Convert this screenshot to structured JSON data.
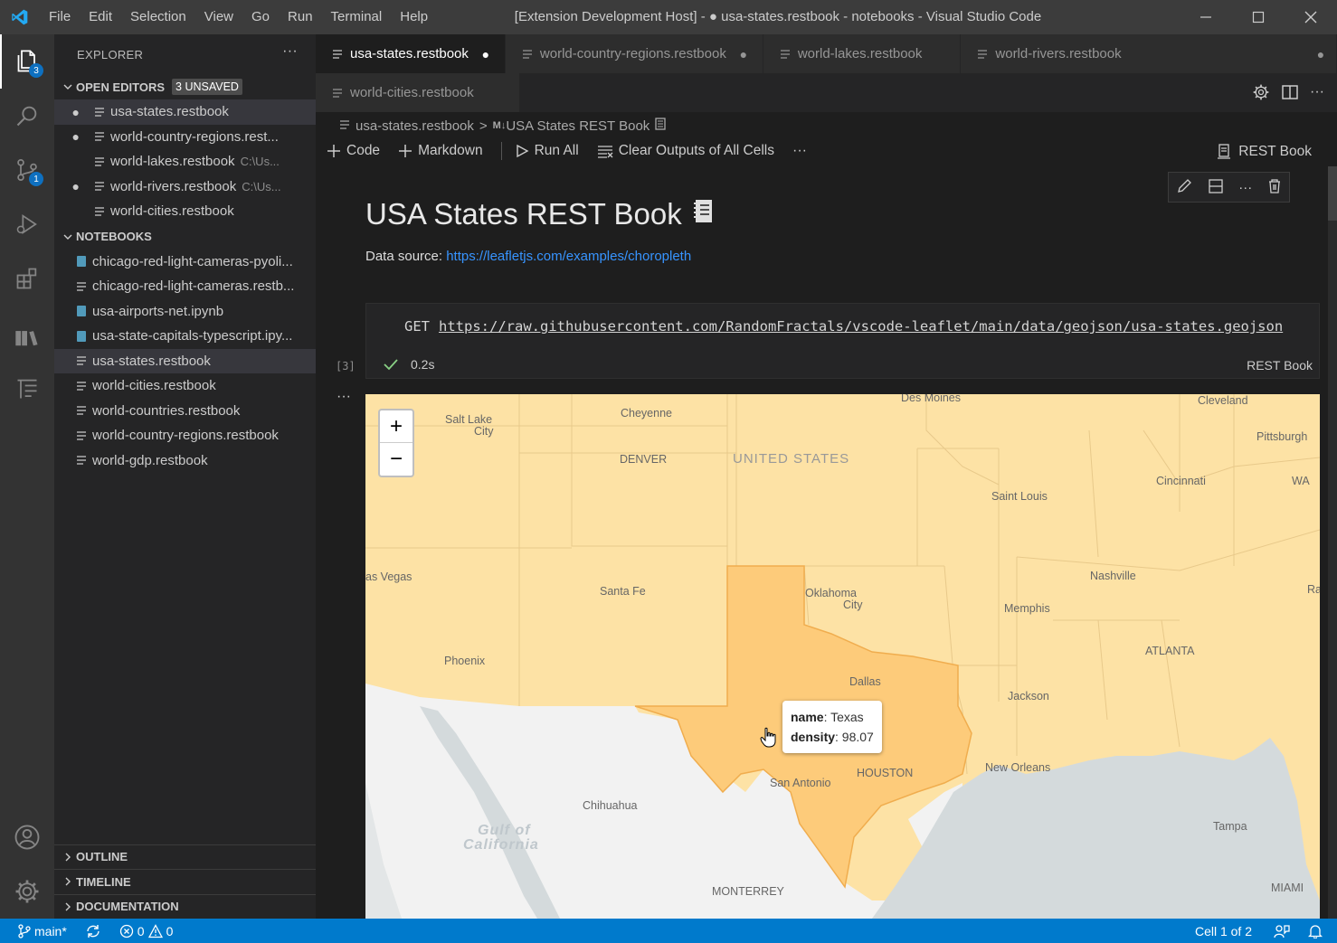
{
  "menu": [
    "File",
    "Edit",
    "Selection",
    "View",
    "Go",
    "Run",
    "Terminal",
    "Help"
  ],
  "window_title": "[Extension Development Host] - ● usa-states.restbook - notebooks - Visual Studio Code",
  "activity": {
    "explorer_badge": "3",
    "scm_badge": "1"
  },
  "sidebar": {
    "title": "EXPLORER",
    "open_editors": {
      "label": "OPEN EDITORS",
      "unsaved": "3 UNSAVED",
      "items": [
        {
          "name": "usa-states.restbook",
          "path": "",
          "dirty": true
        },
        {
          "name": "world-country-regions.rest...",
          "path": "",
          "dirty": true
        },
        {
          "name": "world-lakes.restbook",
          "path": "C:\\Us...",
          "dirty": false
        },
        {
          "name": "world-rivers.restbook",
          "path": "C:\\Us...",
          "dirty": true
        },
        {
          "name": "world-cities.restbook",
          "path": "",
          "dirty": false
        }
      ]
    },
    "notebooks": {
      "label": "NOTEBOOKS",
      "items": [
        {
          "name": "chicago-red-light-cameras-pyoli...",
          "kind": "ipynb"
        },
        {
          "name": "chicago-red-light-cameras.restb...",
          "kind": "restbook"
        },
        {
          "name": "usa-airports-net.ipynb",
          "kind": "ipynb"
        },
        {
          "name": "usa-state-capitals-typescript.ipy...",
          "kind": "ipynb"
        },
        {
          "name": "usa-states.restbook",
          "kind": "restbook"
        },
        {
          "name": "world-cities.restbook",
          "kind": "restbook"
        },
        {
          "name": "world-countries.restbook",
          "kind": "restbook"
        },
        {
          "name": "world-country-regions.restbook",
          "kind": "restbook"
        },
        {
          "name": "world-gdp.restbook",
          "kind": "restbook"
        }
      ]
    },
    "bottom_sections": [
      "OUTLINE",
      "TIMELINE",
      "DOCUMENTATION"
    ]
  },
  "tabs_row1": [
    {
      "label": "usa-states.restbook",
      "dirty": true,
      "active": true
    },
    {
      "label": "world-country-regions.restbook",
      "dirty": true,
      "active": false
    },
    {
      "label": "world-lakes.restbook",
      "dirty": false,
      "active": false
    },
    {
      "label": "world-rivers.restbook",
      "dirty": true,
      "active": false
    }
  ],
  "tabs_row2": [
    {
      "label": "world-cities.restbook",
      "dirty": false,
      "active": false
    }
  ],
  "breadcrumb": {
    "file": "usa-states.restbook",
    "separator": ">",
    "md_prefix": "M↓",
    "section": "USA States REST Book"
  },
  "toolbar": {
    "code": "Code",
    "markdown": "Markdown",
    "run_all": "Run All",
    "clear": "Clear Outputs of All Cells",
    "kernel": "REST Book"
  },
  "markdown": {
    "title": "USA States REST Book",
    "source_label": "Data source:",
    "source_link": "https://leafletjs.com/examples/choropleth"
  },
  "code_cell": {
    "method": "GET",
    "url": "https://raw.githubusercontent.com/RandomFractals/vscode-leaflet/main/data/geojson/usa-states.geojson",
    "exec_count": "[3]",
    "duration": "0.2s",
    "kernel": "REST Book"
  },
  "map": {
    "zoom_in": "+",
    "zoom_out": "−",
    "labels": {
      "des_moines": "Des Moines",
      "cleveland": "Cleveland",
      "salt_lake_1": "Salt Lake",
      "salt_lake_2": "City",
      "cheyenne": "Cheyenne",
      "pittsburgh": "Pittsburgh",
      "denver": "DENVER",
      "united_states": "UNITED STATES",
      "cincinnati": "Cincinnati",
      "wa": "WA",
      "saint_louis": "Saint Louis",
      "las_vegas": "as Vegas",
      "nashville": "Nashville",
      "santa_fe": "Santa Fe",
      "oklahoma_1": "Oklahoma",
      "oklahoma_2": "City",
      "ra": "Ra",
      "memphis": "Memphis",
      "atlanta": "ATLANTA",
      "phoenix": "Phoenix",
      "dallas": "Dallas",
      "jackson": "Jackson",
      "new_orleans": "New Orleans",
      "houston": "HOUSTON",
      "san_antonio": "San Antonio",
      "chihuahua": "Chihuahua",
      "gulf_1": "Gulf of",
      "gulf_2": "California",
      "tampa": "Tampa",
      "monterrey": "MONTERREY",
      "miami": "MIAMI"
    },
    "tooltip": {
      "name_key": "name",
      "name_value": "Texas",
      "density_key": "density",
      "density_value": "98.07"
    },
    "colors": {
      "states": "#fde2a5",
      "highlight": "#fdcb7a",
      "land": "#f2f2f2",
      "water": "#d4dadc"
    }
  },
  "statusbar": {
    "branch": "main*",
    "errors": "0",
    "warnings": "0",
    "cell": "Cell 1 of 2"
  },
  "colors": {
    "accent": "#007acc",
    "link": "#3794ff"
  }
}
